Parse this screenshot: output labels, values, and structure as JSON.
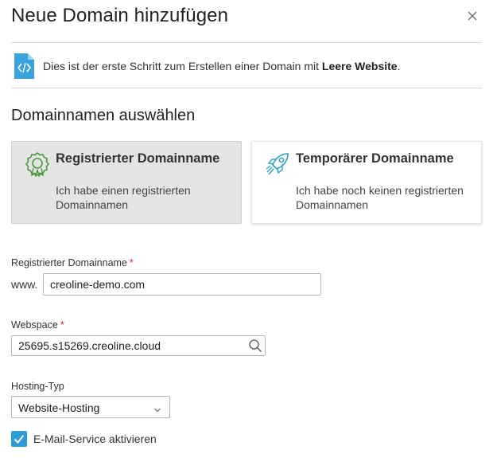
{
  "dialog": {
    "title": "Neue Domain hinzufügen",
    "close_icon": "close-icon"
  },
  "info": {
    "icon": "code-file-icon",
    "text_prefix": "Dies ist der erste Schritt zum Erstellen einer Domain mit ",
    "text_strong": "Leere Website",
    "text_suffix": "."
  },
  "section": {
    "title": "Domainnamen auswählen"
  },
  "options": [
    {
      "icon": "award-badge-icon",
      "title": "Registrierter Domainname",
      "desc": "Ich habe einen registrierten Domainnamen",
      "selected": true
    },
    {
      "icon": "rocket-icon",
      "title": "Temporärer Domainname",
      "desc": "Ich habe noch keinen registrierten Domainnamen",
      "selected": false
    }
  ],
  "domain_field": {
    "label": "Registrierter Domainname",
    "required_mark": "*",
    "prefix": "www.",
    "value": "creoline-demo.com"
  },
  "webspace_field": {
    "label": "Webspace",
    "required_mark": "*",
    "value": "25695.s15269.creoline.cloud",
    "icon": "search-icon"
  },
  "hosting_field": {
    "label": "Hosting-Typ",
    "value": "Website-Hosting",
    "icon": "chevron-down-icon"
  },
  "email_service": {
    "label": "E-Mail-Service aktivieren",
    "checked": true
  },
  "colors": {
    "accent": "#2e9bd6",
    "icon_teal": "#2b9fc9",
    "icon_green": "#4a9a3c",
    "required": "#d2202f",
    "selected_card_bg": "#e5e5e5"
  }
}
